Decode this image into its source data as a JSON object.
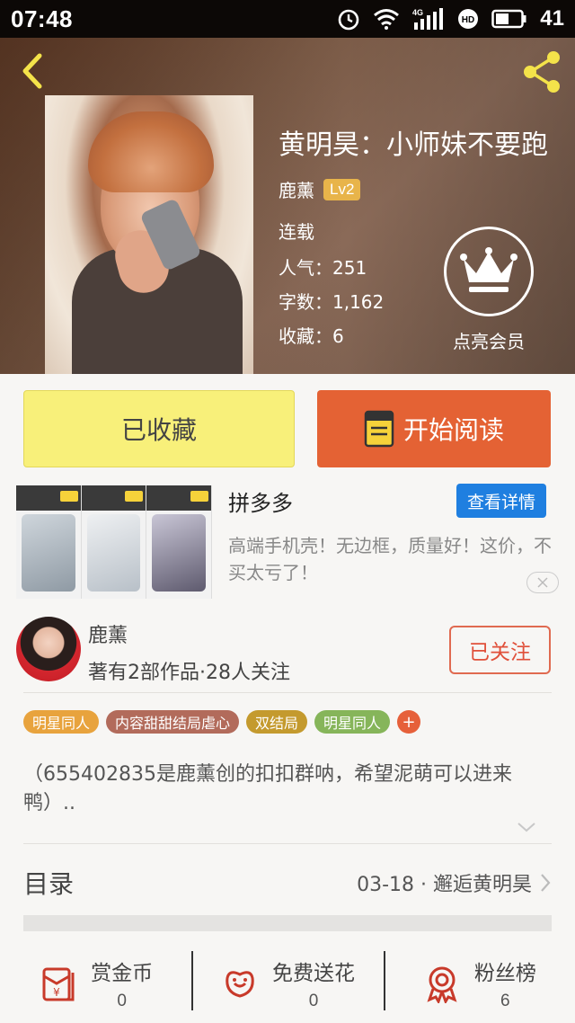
{
  "status_bar": {
    "time": "07:48",
    "signal_label": "4G",
    "hd_label": "HD",
    "battery": "41"
  },
  "book": {
    "title": "黄明昊：小师妹不要跑",
    "author": "鹿薰",
    "level": "Lv2",
    "status": "连载",
    "popularity": "人气：251",
    "word_count": "字数：1,162",
    "favorites": "收藏：6"
  },
  "member": {
    "label": "点亮会员"
  },
  "actions": {
    "collected_label": "已收藏",
    "read_label": "开始阅读"
  },
  "ad": {
    "title": "拼多多",
    "detail_button": "查看详情",
    "description": "高端手机壳！无边框，质量好！这价，不买太亏了！"
  },
  "author_card": {
    "name": "鹿薰",
    "stats": "著有2部作品·28人关注",
    "follow_label": "已关注"
  },
  "tags": [
    {
      "label": "明星同人",
      "color": "#e8a33d"
    },
    {
      "label": "内容甜甜结局虐心",
      "color": "#b26b5b"
    },
    {
      "label": "双结局",
      "color": "#c49a2e"
    },
    {
      "label": "明星同人",
      "color": "#86b55a"
    }
  ],
  "tag_add": "+",
  "summary": "（655402835是鹿薰创的扣扣群呐，希望泥萌可以进来鸭）..",
  "toc": {
    "label": "目录",
    "latest": "03-18 · 邂逅黄明昊"
  },
  "bottom": [
    {
      "label": "赏金币",
      "count": "0",
      "icon": "red-envelope-icon"
    },
    {
      "label": "免费送花",
      "count": "0",
      "icon": "flower-icon"
    },
    {
      "label": "粉丝榜",
      "count": "6",
      "icon": "medal-icon"
    }
  ],
  "colors": {
    "accent": "#e46234",
    "collected_bg": "#f8f07a",
    "link_blue": "#1f7fe0"
  }
}
